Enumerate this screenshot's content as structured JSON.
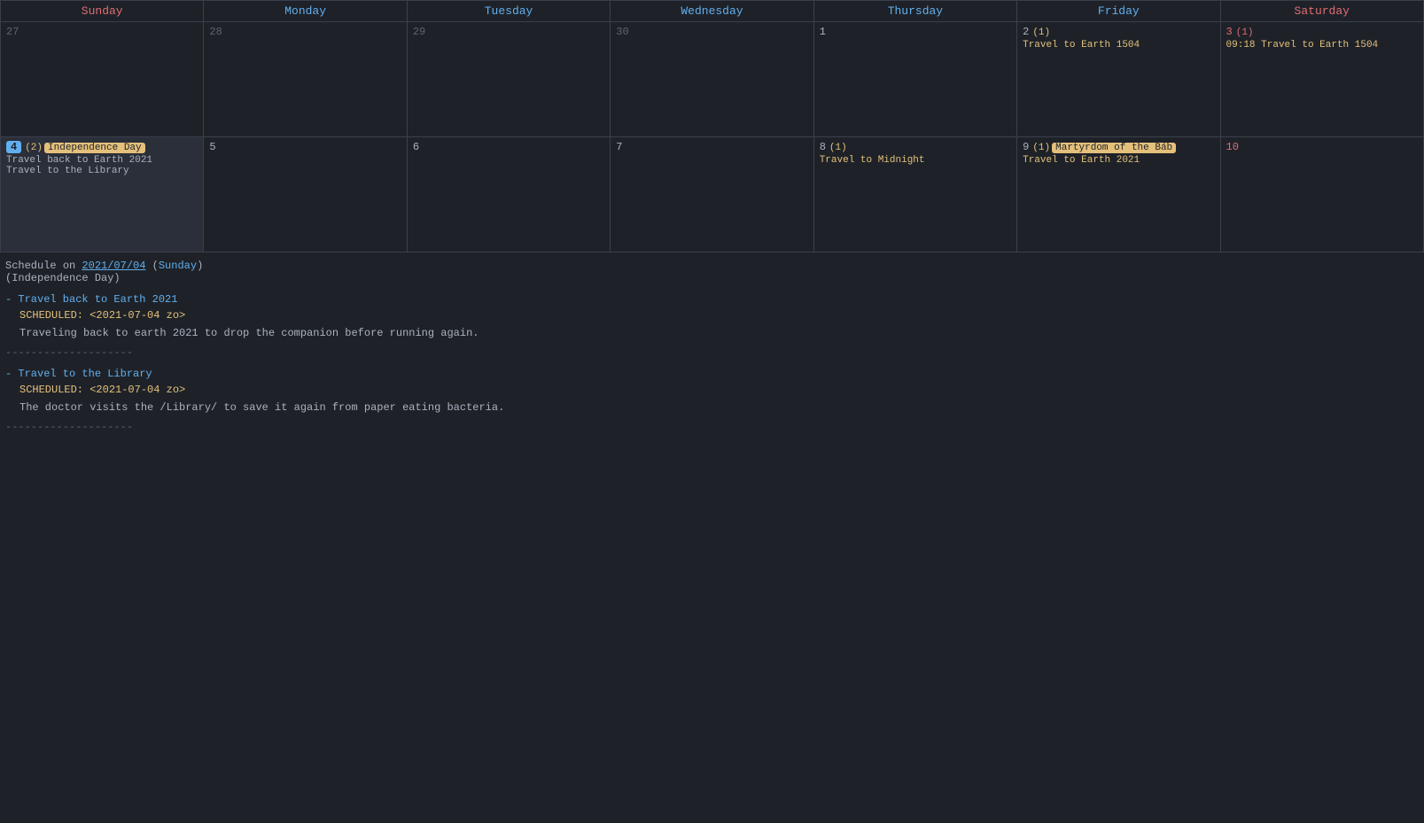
{
  "calendar": {
    "headers": [
      "Sunday",
      "Monday",
      "Tuesday",
      "Wednesday",
      "Thursday",
      "Friday",
      "Saturday"
    ],
    "weeks": [
      {
        "days": [
          {
            "num": "27",
            "outOfMonth": true,
            "events": []
          },
          {
            "num": "28",
            "outOfMonth": true,
            "events": []
          },
          {
            "num": "29",
            "outOfMonth": true,
            "events": []
          },
          {
            "num": "30",
            "outOfMonth": true,
            "events": []
          },
          {
            "num": "1",
            "events": []
          },
          {
            "num": "2",
            "badge": "(1)",
            "events": [
              {
                "text": "Travel to Earth 1504",
                "color": "orange"
              }
            ]
          },
          {
            "num": "3",
            "isSaturday": true,
            "badge": "(1)",
            "events": [
              {
                "text": "09:18 Travel to Earth 1504",
                "color": "orange"
              }
            ]
          }
        ]
      },
      {
        "days": [
          {
            "num": "4",
            "isSelected": true,
            "badge": "(2)",
            "holiday": "Independence Day",
            "events": [
              {
                "text": "Travel back to Earth 2021",
                "color": "default"
              },
              {
                "text": "Travel to the Library",
                "color": "default"
              }
            ]
          },
          {
            "num": "5",
            "events": []
          },
          {
            "num": "6",
            "events": []
          },
          {
            "num": "7",
            "events": []
          },
          {
            "num": "8",
            "badge": "(1)",
            "events": [
              {
                "text": "Travel to Midnight",
                "color": "orange"
              }
            ]
          },
          {
            "num": "9",
            "badge": "(1)",
            "holiday": "Martyrdom of the Báb",
            "events": [
              {
                "text": "Travel to Earth 2021",
                "color": "orange"
              }
            ]
          },
          {
            "num": "10",
            "isSaturday": true,
            "events": []
          }
        ]
      }
    ]
  },
  "schedule": {
    "header_date": "2021/07/04",
    "header_day": "Sunday",
    "header_holiday": "Independence Day",
    "entries": [
      {
        "title": "Travel back to Earth 2021",
        "scheduled": "SCHEDULED: <2021-07-04 zo>",
        "description": "Traveling back to earth 2021 to drop the companion before running again."
      },
      {
        "title": "Travel to the Library",
        "scheduled": "SCHEDULED: <2021-07-04 zo>",
        "description": "The doctor visits the /Library/ to save it again from paper eating bacteria."
      }
    ],
    "divider": "--------------------"
  }
}
